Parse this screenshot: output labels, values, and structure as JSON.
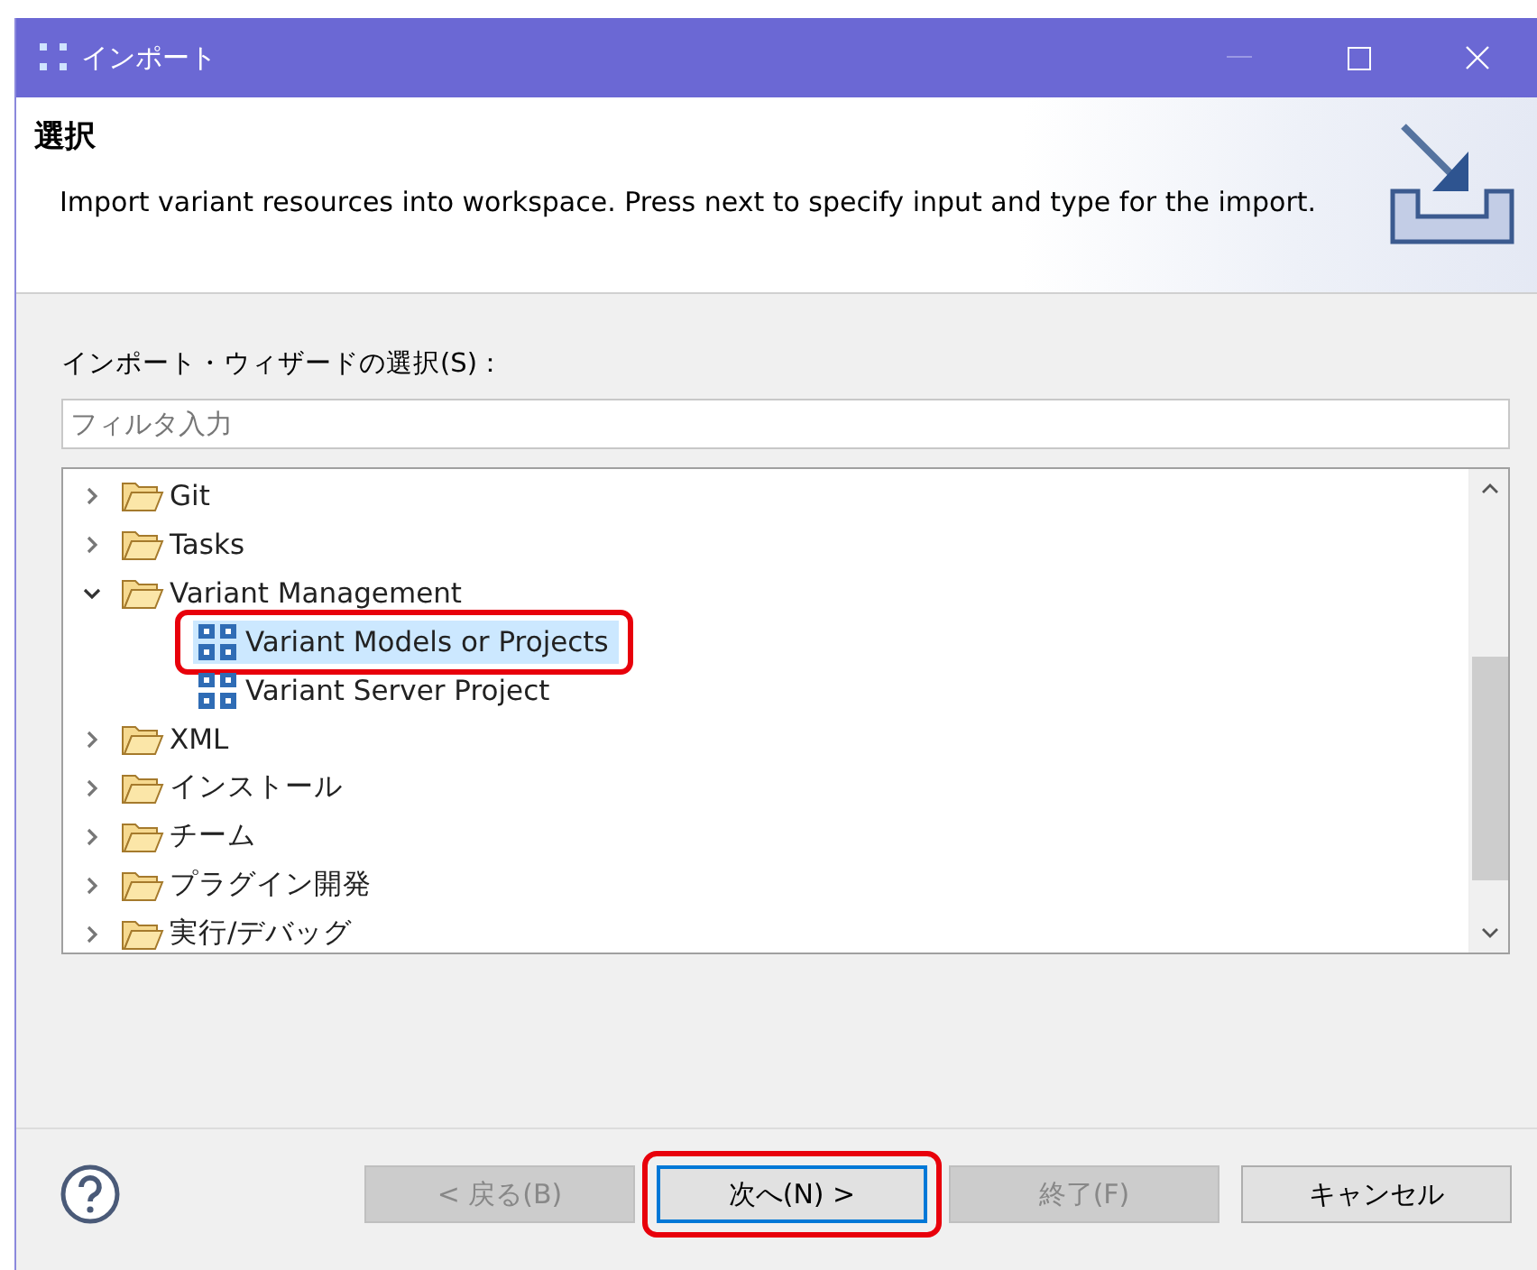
{
  "window": {
    "title": "インポート"
  },
  "header": {
    "title": "選択",
    "description": "Import variant resources into workspace. Press next to specify input and type for the import."
  },
  "wizard_label": "インポート・ウィザードの選択(S)：",
  "filter": {
    "placeholder": "フィルタ入力"
  },
  "tree": [
    {
      "label": "Git",
      "kind": "folder",
      "expanded": false,
      "selected": false
    },
    {
      "label": "Tasks",
      "kind": "folder",
      "expanded": false,
      "selected": false
    },
    {
      "label": "Variant Management",
      "kind": "folder",
      "expanded": true,
      "selected": false,
      "children": [
        {
          "label": "Variant Models or Projects",
          "kind": "wizard",
          "selected": true,
          "highlighted": true
        },
        {
          "label": "Variant Server Project",
          "kind": "wizard",
          "selected": false,
          "highlighted": false
        }
      ]
    },
    {
      "label": "XML",
      "kind": "folder",
      "expanded": false,
      "selected": false
    },
    {
      "label": "インストール",
      "kind": "folder",
      "expanded": false,
      "selected": false
    },
    {
      "label": "チーム",
      "kind": "folder",
      "expanded": false,
      "selected": false
    },
    {
      "label": "プラグイン開発",
      "kind": "folder",
      "expanded": false,
      "selected": false
    },
    {
      "label": "実行/デバッグ",
      "kind": "folder",
      "expanded": false,
      "selected": false
    }
  ],
  "buttons": [
    {
      "label": "< 戻る(B)",
      "disabled": true,
      "focused": false,
      "highlighted": false
    },
    {
      "label": "次へ(N) >",
      "disabled": false,
      "focused": true,
      "highlighted": true
    },
    {
      "label": "終了(F)",
      "disabled": true,
      "focused": false,
      "highlighted": false
    },
    {
      "label": "キャンセル",
      "disabled": false,
      "focused": false,
      "highlighted": false
    }
  ]
}
